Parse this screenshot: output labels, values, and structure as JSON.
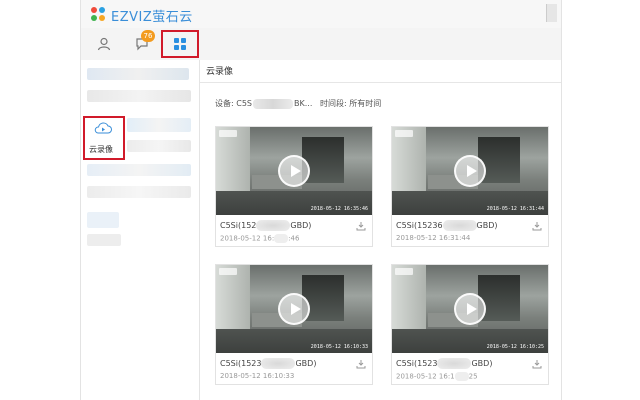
{
  "app": {
    "logo_text": "EZVIZ萤石云"
  },
  "toolbar": {
    "message_badge": "76"
  },
  "sidebar": {
    "cloud_label": "云录像"
  },
  "panel": {
    "title": "云录像"
  },
  "info": {
    "device_label": "设备:",
    "device_prefix": "C5S",
    "device_suffix": "BK...",
    "period_label": "时间段:",
    "period_value": "所有时间"
  },
  "recordings": [
    {
      "name_prefix": "C5Si(152",
      "name_suffix": "GBD)",
      "time_prefix": "2018-05-12 16:",
      "time_suffix": ":46",
      "stamp": "2018-05-12 16:35:46"
    },
    {
      "name_prefix": "C5Si(15236",
      "name_suffix": "GBD)",
      "time_prefix": "2018-05-12 16:31:44",
      "time_suffix": "",
      "stamp": "2018-05-12 16:31:44"
    },
    {
      "name_prefix": "C5Si(1523",
      "name_suffix": "GBD)",
      "time_prefix": "2018-05-12 16:10:33",
      "time_suffix": "",
      "stamp": "2018-05-12 16:10:33"
    },
    {
      "name_prefix": "C5Si(1523",
      "name_suffix": "GBD)",
      "time_prefix": "2018-05-12 16:1",
      "time_suffix": "25",
      "stamp": "2018-05-12 16:10:25"
    }
  ]
}
